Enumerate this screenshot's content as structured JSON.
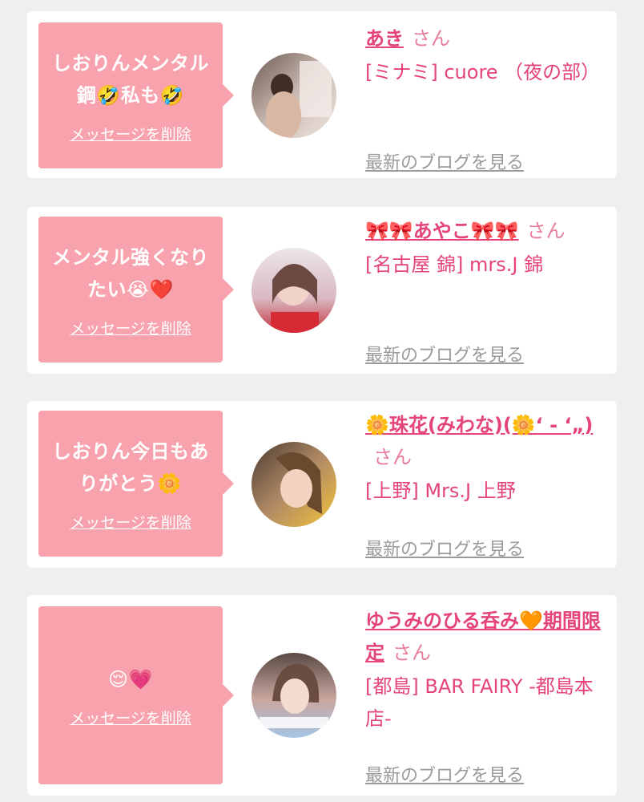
{
  "messages": [
    {
      "text": "しおりんメンタル鋼🤣私も🤣",
      "delete_label": "メッセージを削除",
      "name": "あき",
      "honorific": "さん",
      "shop": "[ミナミ] cuore （夜の部）",
      "blog_label": "最新のブログを見る"
    },
    {
      "text": "メンタル強くなりたい😭❤️",
      "delete_label": "メッセージを削除",
      "name": "🎀🎀あやこ🎀🎀",
      "honorific": "さん",
      "shop": "[名古屋 錦] mrs.J 錦",
      "blog_label": "最新のブログを見る"
    },
    {
      "text": "しおりん今日もありがとう🌼",
      "delete_label": "メッセージを削除",
      "name": "🌼珠花(みわな)(🌼‘ - ‘„)",
      "honorific": "さん",
      "shop": "[上野] Mrs.J 上野",
      "blog_label": "最新のブログを見る"
    },
    {
      "text": "😌💗",
      "delete_label": "メッセージを削除",
      "name": "ゆうみのひる呑み🧡期間限定",
      "honorific": "さん",
      "shop": "[都島] BAR FAIRY -都島本店-",
      "blog_label": "最新のブログを見る"
    }
  ],
  "colors": {
    "bubble": "#f8a2ad",
    "name": "#e5447b",
    "link_gray": "#9a9a9a",
    "background": "#efefef"
  }
}
